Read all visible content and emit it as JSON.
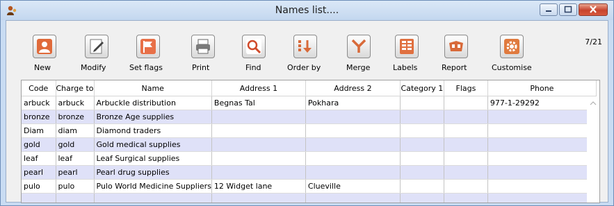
{
  "window": {
    "title": "Names list....",
    "counter": "7/21",
    "accent_color": "#c9dcf3"
  },
  "toolbar": {
    "buttons": [
      {
        "label": "New",
        "icon": "person-icon"
      },
      {
        "label": "Modify",
        "icon": "pencil-document-icon"
      },
      {
        "label": "Set flags",
        "icon": "flag-icon"
      },
      {
        "label": "Print",
        "icon": "printer-icon"
      },
      {
        "label": "Find",
        "icon": "magnifier-icon"
      },
      {
        "label": "Order by",
        "icon": "sort-icon"
      },
      {
        "label": "Merge",
        "icon": "merge-icon"
      },
      {
        "label": "Labels",
        "icon": "labels-icon"
      },
      {
        "label": "Report",
        "icon": "report-icon"
      },
      {
        "label": "Customise",
        "icon": "cog-icon"
      }
    ]
  },
  "table": {
    "columns": [
      "Code",
      "Charge to",
      "Name",
      "Address 1",
      "Address 2",
      "Category 1",
      "Flags",
      "Phone"
    ],
    "rows": [
      [
        "arbuck",
        "arbuck",
        "Arbuckle distribution",
        "Begnas Tal",
        "Pokhara",
        "",
        "",
        "977-1-29292"
      ],
      [
        "bronze",
        "bronze",
        "Bronze Age supplies",
        "",
        "",
        "",
        "",
        ""
      ],
      [
        "Diam",
        "diam",
        "Diamond traders",
        "",
        "",
        "",
        "",
        ""
      ],
      [
        "gold",
        "gold",
        "Gold medical supplies",
        "",
        "",
        "",
        "",
        ""
      ],
      [
        "leaf",
        "leaf",
        "Leaf Surgical supplies",
        "",
        "",
        "",
        "",
        ""
      ],
      [
        "pearl",
        "pearl",
        "Pearl drug supplies",
        "",
        "",
        "",
        "",
        ""
      ],
      [
        "pulo",
        "pulo",
        "Pulo World Medicine Suppliers",
        "12 Widget lane",
        "Clueville",
        "",
        "",
        ""
      ],
      [
        "",
        "",
        "",
        "",
        "",
        "",
        "",
        ""
      ]
    ],
    "alt_row_color": "#dfe1f8"
  }
}
